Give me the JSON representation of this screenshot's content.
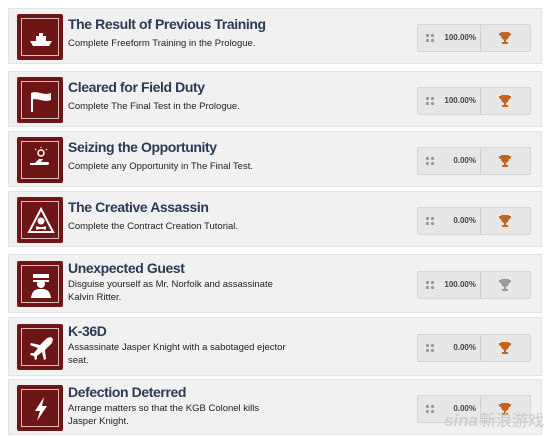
{
  "achievements": [
    {
      "title": "The Result of Previous Training",
      "description": "Complete Freeform Training in the Prologue.",
      "percent": "100.00%",
      "icon": "boat-icon",
      "trophy_color": "#c4651e"
    },
    {
      "title": "Cleared for Field Duty",
      "description": "Complete The Final Test in the Prologue.",
      "percent": "100.00%",
      "icon": "flag-icon",
      "trophy_color": "#c4651e"
    },
    {
      "title": "Seizing the Opportunity",
      "description": "Complete any Opportunity in The Final Test.",
      "percent": "0.00%",
      "icon": "hand-lightbulb-icon",
      "trophy_color": "#c4651e"
    },
    {
      "title": "The Creative Assassin",
      "description": "Complete the Contract Creation Tutorial.",
      "percent": "0.00%",
      "icon": "skull-warning-icon",
      "trophy_color": "#c4651e"
    },
    {
      "title": "Unexpected Guest",
      "description": "Disguise yourself as Mr. Norfolk and assassinate Kalvin Ritter.",
      "percent": "100.00%",
      "icon": "masked-guest-icon",
      "trophy_color": "#9a9a9a"
    },
    {
      "title": "K-36D",
      "description": "Assassinate Jasper Knight with a sabotaged ejector seat.",
      "percent": "0.00%",
      "icon": "jet-icon",
      "trophy_color": "#c4651e"
    },
    {
      "title": "Defection Deterred",
      "description": "Arrange matters so that the KGB Colonel kills Jasper Knight.",
      "percent": "0.00%",
      "icon": "lightning-icon",
      "trophy_color": "#c4651e"
    }
  ],
  "watermark": {
    "brand": "sina",
    "text": "新浪游戏"
  }
}
